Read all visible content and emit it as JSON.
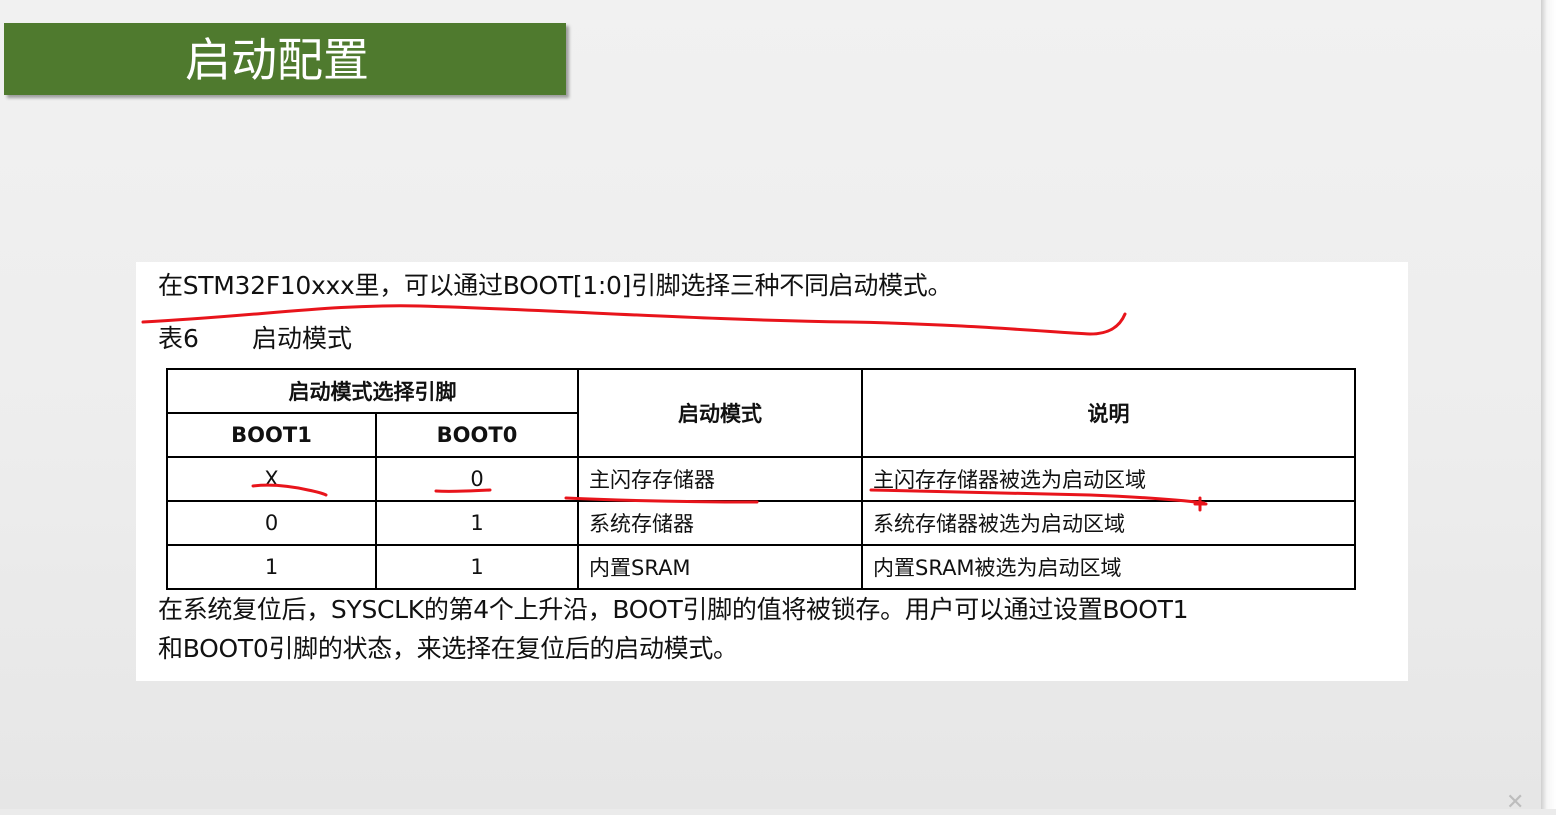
{
  "slide": {
    "title": "启动配置",
    "accent_color": "#4f7a2e"
  },
  "doc": {
    "intro": "在STM32F10xxx里，可以通过BOOT[1:0]引脚选择三种不同启动模式。",
    "caption_number": "表6",
    "caption_title": "启动模式",
    "table": {
      "group_header": "启动模式选择引脚",
      "col_boot1": "BOOT1",
      "col_boot0": "BOOT0",
      "col_mode": "启动模式",
      "col_desc": "说明",
      "rows": [
        {
          "boot1": "X",
          "boot0": "0",
          "mode": "主闪存存储器",
          "desc": "主闪存存储器被选为启动区域"
        },
        {
          "boot1": "0",
          "boot0": "1",
          "mode": "系统存储器",
          "desc": "系统存储器被选为启动区域"
        },
        {
          "boot1": "1",
          "boot0": "1",
          "mode": "内置SRAM",
          "desc": "内置SRAM被选为启动区域"
        }
      ]
    },
    "outro_line1": "在系统复位后，SYSCLK的第4个上升沿，BOOT引脚的值将被锁存。用户可以通过设置BOOT1",
    "outro_line2": "和BOOT0引脚的状态，来选择在复位后的启动模式。"
  },
  "annotation": {
    "ink_color": "#e8141b"
  }
}
